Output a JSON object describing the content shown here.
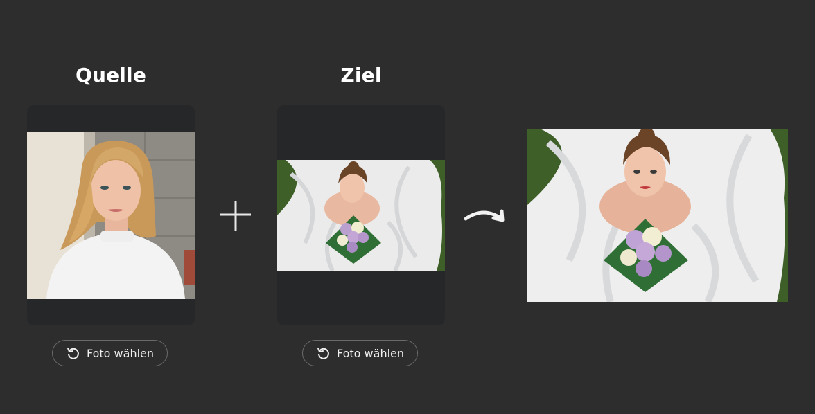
{
  "source": {
    "title": "Quelle",
    "button_label": "Foto wählen",
    "button_icon": "reset-icon"
  },
  "target": {
    "title": "Ziel",
    "button_label": "Foto wählen",
    "button_icon": "reset-icon"
  },
  "operators": {
    "combine_icon": "plus-icon",
    "result_icon": "curved-arrow-icon"
  },
  "colors": {
    "background": "#2d2d2d",
    "card": "#262729",
    "text": "#ffffff",
    "button_border": "#6a6a6a"
  }
}
